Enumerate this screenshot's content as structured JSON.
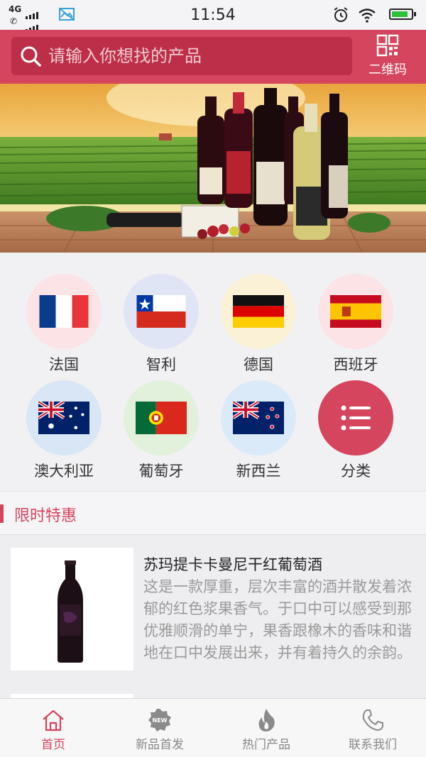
{
  "status_bar": {
    "network": "4G",
    "time": "11:54",
    "battery_level": 0.85,
    "battery_color": "#2fbf3c"
  },
  "search": {
    "placeholder": "请输入你想找的产品",
    "qr_label": "二维码"
  },
  "colors": {
    "accent": "#d5455e"
  },
  "countries": [
    {
      "label": "法国",
      "circle": "#fbe3e6"
    },
    {
      "label": "智利",
      "circle": "#dfe5f4"
    },
    {
      "label": "德国",
      "circle": "#fbf1d7"
    },
    {
      "label": "西班牙",
      "circle": "#fbe3e6"
    },
    {
      "label": "澳大利亚",
      "circle": "#d9e6f5"
    },
    {
      "label": "葡萄牙",
      "circle": "#e1f1dc"
    },
    {
      "label": "新西兰",
      "circle": "#dbeaf8"
    },
    {
      "label": "分类",
      "circle": "#d5455e"
    }
  ],
  "section": {
    "title": "限时特惠"
  },
  "product": {
    "name": "苏玛提卡卡曼尼干红葡萄酒",
    "description": "这是一款厚重，层次丰富的酒并散发着浓郁的红色浆果香气。于口中可以感受到那优雅顺滑的单宁，果香跟橡木的香味和谐地在口中发展出来，并有着持久的余韵。"
  },
  "tabs": [
    {
      "label": "首页",
      "icon": "home-icon",
      "active": true
    },
    {
      "label": "新品首发",
      "icon": "new-badge-icon",
      "active": false
    },
    {
      "label": "热门产品",
      "icon": "flame-icon",
      "active": false
    },
    {
      "label": "联系我们",
      "icon": "phone-icon",
      "active": false
    }
  ]
}
